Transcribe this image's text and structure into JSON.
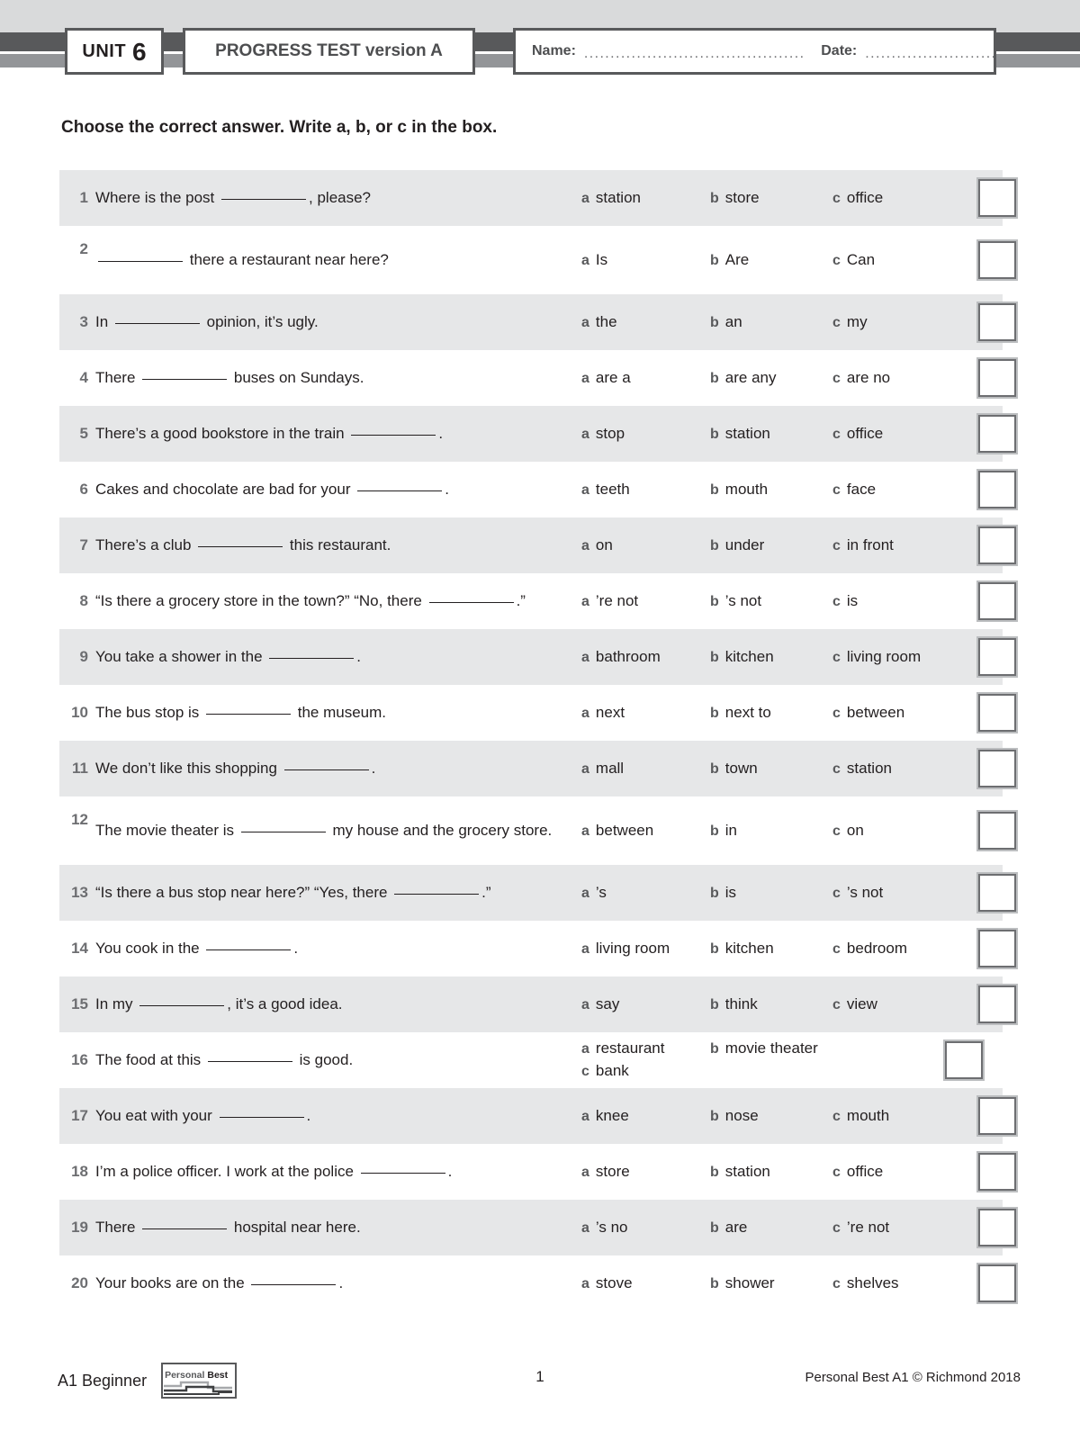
{
  "header": {
    "unit_word": "UNIT",
    "unit_number": "6",
    "test_title": "PROGRESS TEST version A",
    "name_label": "Name:",
    "name_dots": "...............................................................",
    "date_label": "Date:",
    "date_dots": "................................."
  },
  "instruction": "Choose the correct answer. Write a, b, or c in the box.",
  "questions": [
    {
      "num": "1",
      "pre": "Where is the post",
      "post": ", please?",
      "a": "station",
      "b": "store",
      "c": "office"
    },
    {
      "num": "2",
      "pre": "",
      "post": "there a restaurant near here?",
      "a": "Is",
      "b": "Are",
      "c": "Can"
    },
    {
      "num": "3",
      "pre": "In",
      "post": "opinion, it’s ugly.",
      "a": "the",
      "b": "an",
      "c": "my"
    },
    {
      "num": "4",
      "pre": "There",
      "post": "buses on Sundays.",
      "a": "are a",
      "b": "are any",
      "c": "are no"
    },
    {
      "num": "5",
      "pre": "There’s a good bookstore in the train",
      "post": ".",
      "a": "stop",
      "b": "station",
      "c": "office"
    },
    {
      "num": "6",
      "pre": "Cakes and chocolate are bad for your",
      "post": ".",
      "a": "teeth",
      "b": "mouth",
      "c": "face"
    },
    {
      "num": "7",
      "pre": "There’s a club",
      "post": "this restaurant.",
      "a": "on",
      "b": "under",
      "c": "in front"
    },
    {
      "num": "8",
      "pre": "“Is there a grocery store in the town?” “No, there",
      "post": ".”",
      "a": "’re not",
      "b": "’s not",
      "c": "is"
    },
    {
      "num": "9",
      "pre": "You take a shower in the",
      "post": ".",
      "a": "bathroom",
      "b": "kitchen",
      "c": "living room"
    },
    {
      "num": "10",
      "pre": "The bus stop is",
      "post": "the museum.",
      "a": "next",
      "b": "next to",
      "c": "between"
    },
    {
      "num": "11",
      "pre": "We don’t like this shopping",
      "post": ".",
      "a": "mall",
      "b": "town",
      "c": "station"
    },
    {
      "num": "12",
      "pre": "The movie theater is",
      "post": "my house and the grocery store.",
      "a": "between",
      "b": "in",
      "c": "on"
    },
    {
      "num": "13",
      "pre": "“Is there a bus stop near here?” “Yes, there",
      "post": ".”",
      "a": "’s",
      "b": "is",
      "c": "’s not"
    },
    {
      "num": "14",
      "pre": "You cook in the",
      "post": ".",
      "a": "living room",
      "b": "kitchen",
      "c": "bedroom"
    },
    {
      "num": "15",
      "pre": "In my",
      "post": ", it’s a good idea.",
      "a": "say",
      "b": "think",
      "c": "view"
    },
    {
      "num": "16",
      "pre": "The food at this",
      "post": "is good.",
      "a": "restaurant",
      "b": "movie theater",
      "c": "bank",
      "wrapped": true
    },
    {
      "num": "17",
      "pre": "You eat with your",
      "post": ".",
      "a": "knee",
      "b": "nose",
      "c": "mouth"
    },
    {
      "num": "18",
      "pre": "I’m a police officer. I work at the police",
      "post": ".",
      "a": "store",
      "b": "station",
      "c": "office"
    },
    {
      "num": "19",
      "pre": "There",
      "post": "hospital near here.",
      "a": "’s no",
      "b": "are",
      "c": "’re not"
    },
    {
      "num": "20",
      "pre": "Your books are on the",
      "post": ".",
      "a": "stove",
      "b": "shower",
      "c": "shelves"
    }
  ],
  "option_letters": {
    "a": "a",
    "b": "b",
    "c": "c"
  },
  "footer": {
    "level": "A1 Beginner",
    "logo_personal": "Personal",
    "logo_best": "Best",
    "page_number": "1",
    "copyright": "Personal Best A1 © Richmond 2018"
  }
}
